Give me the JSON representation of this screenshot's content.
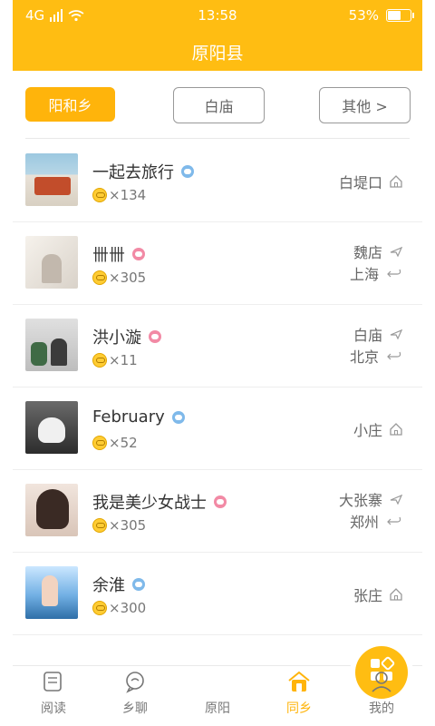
{
  "status_bar": {
    "network": "4G",
    "time": "13:58",
    "battery_percent": "53%"
  },
  "header": {
    "title": "原阳县"
  },
  "tabs": [
    {
      "label": "阳和乡"
    },
    {
      "label": "白庙"
    },
    {
      "label": "其他 >"
    }
  ],
  "people": [
    {
      "name": "一起去旅行",
      "gender": "male",
      "coins": "×134",
      "location": [
        "白堤口"
      ]
    },
    {
      "name": "卌卌",
      "gender": "female",
      "coins": "×305",
      "location": [
        "魏店",
        "上海"
      ]
    },
    {
      "name": "洪小漩",
      "gender": "female",
      "coins": "×11",
      "location": [
        "白庙",
        "北京"
      ]
    },
    {
      "name": "February",
      "gender": "male",
      "coins": "×52",
      "location": [
        "小庄"
      ]
    },
    {
      "name": "我是美少女战士",
      "gender": "female",
      "coins": "×305",
      "location": [
        "大张寨",
        "郑州"
      ]
    },
    {
      "name": "余淮",
      "gender": "male",
      "coins": "×300",
      "location": [
        "张庄"
      ]
    }
  ],
  "bottom_nav": [
    {
      "label": "阅读"
    },
    {
      "label": "乡聊"
    },
    {
      "label": "原阳"
    },
    {
      "label": "同乡"
    },
    {
      "label": "我的"
    }
  ],
  "colors": {
    "accent": "#ffbd12",
    "text": "#333333",
    "muted": "#777777"
  }
}
